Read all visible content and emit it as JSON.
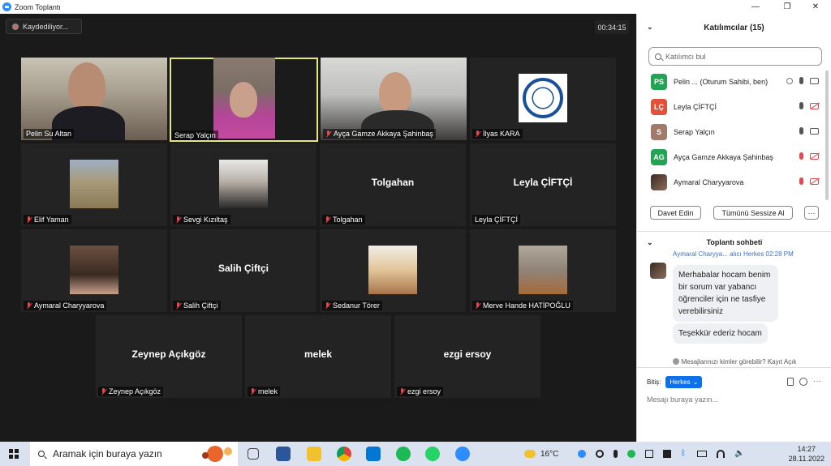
{
  "window": {
    "title": "Zoom Toplantı",
    "controls": [
      "—",
      "❐",
      "✕"
    ]
  },
  "meeting": {
    "recording_label": "Kaydediliyor...",
    "timer": "00:34:15"
  },
  "tiles": [
    {
      "name": "Pelin Su Altan",
      "muted": false,
      "video": true,
      "active": false
    },
    {
      "name": "Serap Yalçın",
      "muted": false,
      "video": true,
      "active": true
    },
    {
      "name": "Ayça Gamze Akkaya Şahinbaş",
      "muted": true,
      "video": true,
      "active": false
    },
    {
      "name": "İlyas KARA",
      "muted": true,
      "video": true,
      "active": false
    },
    {
      "name": "Elif Yaman",
      "muted": true,
      "video": true,
      "active": false
    },
    {
      "name": "Sevgi Kızıltaş",
      "muted": true,
      "video": true,
      "active": false
    },
    {
      "name": "Tolgahan",
      "display": "Tolgahan",
      "muted": true,
      "video": false,
      "active": false
    },
    {
      "name": "Leyla ÇİFTÇİ",
      "display": "Leyla ÇİFTÇİ",
      "muted": false,
      "video": false,
      "active": false
    },
    {
      "name": "Aymaral Charyyarova",
      "muted": true,
      "video": true,
      "active": false
    },
    {
      "name": "Salih  Çiftçi",
      "display": "Salih  Çiftçi",
      "muted": true,
      "video": false,
      "active": false
    },
    {
      "name": "Sedanur Törer",
      "muted": true,
      "video": true,
      "active": false
    },
    {
      "name": "Merve Hande HATİPOĞLU",
      "muted": true,
      "video": true,
      "active": false
    },
    {
      "name": "Zeynep Açıkgöz",
      "display": "Zeynep Açıkgöz",
      "muted": true,
      "video": false,
      "active": false
    },
    {
      "name": "melek",
      "display": "melek",
      "muted": true,
      "video": false,
      "active": false
    },
    {
      "name": "ezgi ersoy",
      "display": "ezgi ersoy",
      "muted": true,
      "video": false,
      "active": false
    }
  ],
  "participants": {
    "title": "Katılımcılar (15)",
    "search_placeholder": "Katılımcı bul",
    "list": [
      {
        "initials": "PS",
        "color": "#23a455",
        "name": "Pelin ...",
        "role": "(Oturum Sahibi, ben)",
        "mic": "on",
        "cam": "on"
      },
      {
        "initials": "LÇ",
        "color": "#e0533a",
        "name": "Leyla ÇİFTÇİ",
        "role": "",
        "mic": "on",
        "cam": "off"
      },
      {
        "initials": "S",
        "color": "#a07a6b",
        "name": "Serap Yalçın",
        "role": "",
        "mic": "on",
        "cam": "on"
      },
      {
        "initials": "AG",
        "color": "#23a455",
        "name": "Ayça Gamze Akkaya Şahinbaş",
        "role": "",
        "mic": "off",
        "cam": "off"
      },
      {
        "initials": "",
        "color": "#3a2a22",
        "name": "Aymaral Charyyarova",
        "role": "",
        "mic": "off",
        "cam": "off"
      }
    ],
    "invite_label": "Davet Edin",
    "mute_all_label": "Tümünü Sessize Al",
    "more_label": "···"
  },
  "chat": {
    "title": "Toplantı sohbeti",
    "from_line": "Aymaral Charyya...  alıcı Herkes  02:28 PM",
    "messages": [
      "Merhabalar hocam benim bir sorum var yabancı öğrenciler için ne tasfiye verebilirsiniz",
      "Teşekkür ederiz hocam"
    ],
    "visibility_note": "Mesajlarınızı kimler görebilir? Kayıt Açık",
    "to_label": "Bitiş:",
    "recipient": "Herkes",
    "input_placeholder": "Mesajı buraya yazın..."
  },
  "taskbar": {
    "search_placeholder": "Aramak için buraya yazın",
    "weather": "16°C",
    "time": "14:27",
    "date": "28.11.2022"
  }
}
